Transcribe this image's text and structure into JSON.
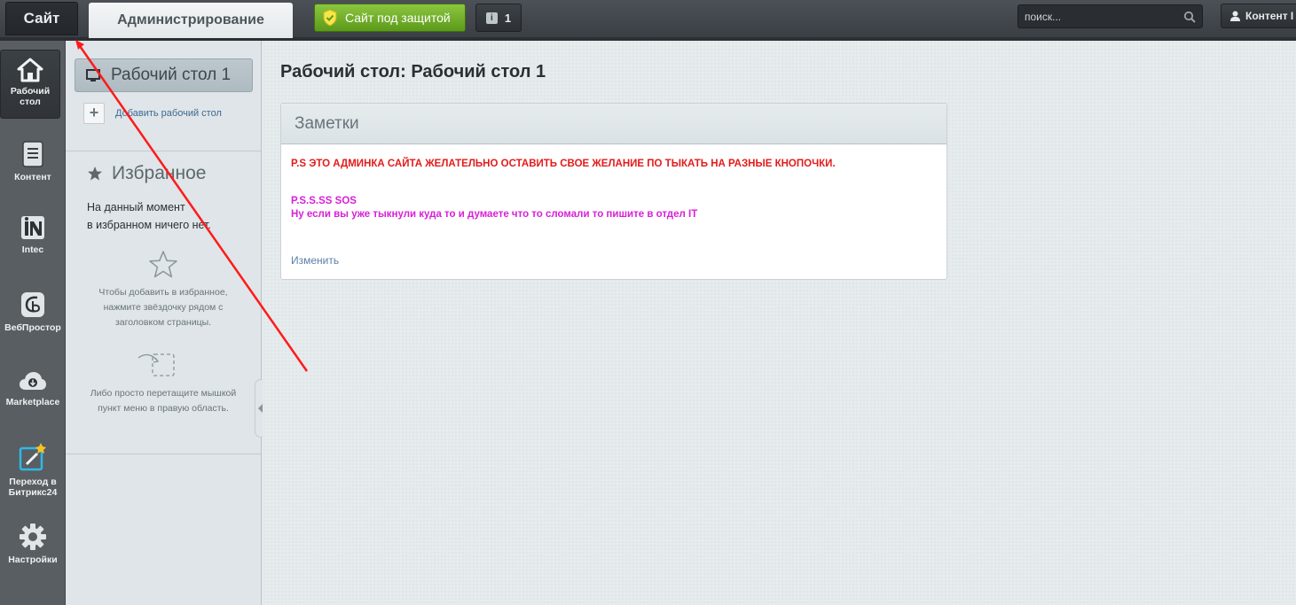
{
  "topbar": {
    "site_tab": "Сайт",
    "admin_tab": "Администрирование",
    "protected_label": "Сайт под защитой",
    "notifications_count": "1",
    "search_placeholder": "поиск...",
    "user_label": "Контент I"
  },
  "nav": {
    "items": [
      {
        "label": "Рабочий стол",
        "icon": "home-icon",
        "active": true
      },
      {
        "label": "Контент",
        "icon": "document-icon"
      },
      {
        "label": "Intec",
        "icon": "intec-icon"
      },
      {
        "label": "ВебПростор",
        "icon": "webprostor-icon"
      },
      {
        "label": "Marketplace",
        "icon": "cloud-download-icon"
      },
      {
        "label": "Переход в Битрикс24",
        "icon": "bitrix24-icon"
      },
      {
        "label": "Настройки",
        "icon": "gear-icon"
      }
    ]
  },
  "sidebar": {
    "desktop_tab": "Рабочий стол 1",
    "add_desktop": "Добавить рабочий стол",
    "favorites_title": "Избранное",
    "favorites_empty_line1": "На данный момент",
    "favorites_empty_line2": "в избранном ничего нет.",
    "hint_star": "Чтобы добавить в избранное, нажмите звёздочку рядом с заголовком страницы.",
    "hint_drag": "Либо просто перетащите мышкой пункт меню в правую область."
  },
  "main": {
    "title": "Рабочий стол: Рабочий стол 1",
    "notes": {
      "header": "Заметки",
      "line_red": "P.S ЭТО АДМИНКА САЙТА ЖЕЛАТЕЛЬНО ОСТАВИТЬ СВОЕ ЖЕЛАНИЕ ПО ТЫКАТЬ НА РАЗНЫЕ КНОПОЧКИ.",
      "line_pink1": "P.S.S.SS SOS",
      "line_pink2": "Ну если вы уже тыкнули куда то и думаете что то сломали то пишите в отдел IT",
      "edit_link": "Изменить"
    }
  },
  "colors": {
    "accent_green": "#6fae2a",
    "note_red": "#e31b1b",
    "note_pink": "#d81fd8",
    "annotation_arrow": "#ff1a1a"
  }
}
